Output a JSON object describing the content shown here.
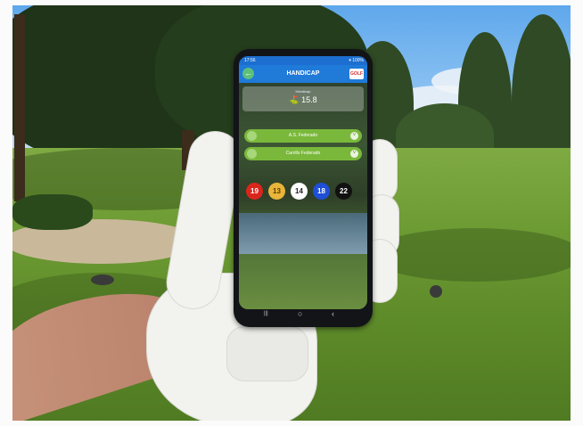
{
  "photo": {
    "description_icons": [
      "golf-course",
      "gloved-hand",
      "smartphone"
    ]
  },
  "app": {
    "status_time": "17:56",
    "status_right": "▾ 100%",
    "title": "HANDICAP",
    "logo_text": "GOLF",
    "back_glyph": "←",
    "handicap_label": "Hándicap",
    "handicap_value": "15.8",
    "handicap_icon": "⛳",
    "players": [
      {
        "name": "A.S. Federado",
        "chevron": "˅"
      },
      {
        "name": "Carrillo Federado",
        "chevron": "˅"
      }
    ],
    "tees": [
      {
        "number": "19",
        "bg": "#d9261c",
        "fg": "#ffffff"
      },
      {
        "number": "13",
        "bg": "#e8b53a",
        "fg": "#5a3a00"
      },
      {
        "number": "14",
        "bg": "#ffffff",
        "fg": "#222222"
      },
      {
        "number": "18",
        "bg": "#1f4fd6",
        "fg": "#ffffff"
      },
      {
        "number": "22",
        "bg": "#111111",
        "fg": "#ffffff"
      }
    ],
    "nav": {
      "recent": "|||",
      "home": "○",
      "back": "‹"
    }
  },
  "colors": {
    "appbar": "#1f7ad8",
    "pill": "#7ab83b"
  }
}
